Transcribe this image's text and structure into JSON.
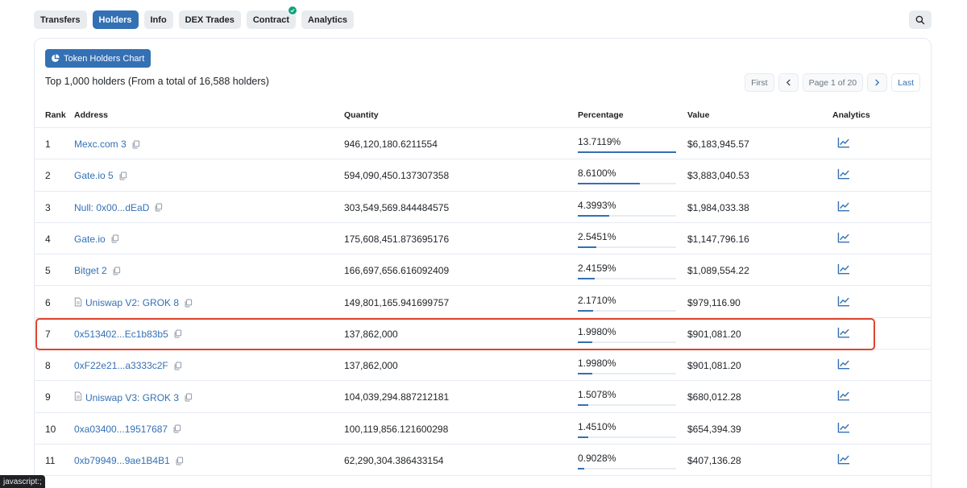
{
  "tabs": [
    {
      "label": "Transfers"
    },
    {
      "label": "Holders",
      "active": true
    },
    {
      "label": "Info"
    },
    {
      "label": "DEX Trades"
    },
    {
      "label": "Contract",
      "verified": true
    },
    {
      "label": "Analytics"
    }
  ],
  "chart_button": "Token Holders Chart",
  "summary": "Top 1,000 holders (From a total of 16,588 holders)",
  "pager": {
    "first": "First",
    "page": "Page 1 of 20",
    "last": "Last"
  },
  "columns": {
    "rank": "Rank",
    "address": "Address",
    "quantity": "Quantity",
    "percentage": "Percentage",
    "value": "Value",
    "analytics": "Analytics"
  },
  "rows": [
    {
      "rank": "1",
      "address": "Mexc.com 3",
      "quantity": "946,120,180.6211554",
      "percentage": "13.7119%",
      "pct_fill": 1.0,
      "value": "$6,183,945.57"
    },
    {
      "rank": "2",
      "address": "Gate.io 5",
      "quantity": "594,090,450.137307358",
      "percentage": "8.6100%",
      "pct_fill": 0.628,
      "value": "$3,883,040.53"
    },
    {
      "rank": "3",
      "address": "Null: 0x00...dEaD",
      "quantity": "303,549,569.844484575",
      "percentage": "4.3993%",
      "pct_fill": 0.321,
      "value": "$1,984,033.38"
    },
    {
      "rank": "4",
      "address": "Gate.io",
      "quantity": "175,608,451.873695176",
      "percentage": "2.5451%",
      "pct_fill": 0.186,
      "value": "$1,147,796.16"
    },
    {
      "rank": "5",
      "address": "Bitget 2",
      "quantity": "166,697,656.616092409",
      "percentage": "2.4159%",
      "pct_fill": 0.176,
      "value": "$1,089,554.22"
    },
    {
      "rank": "6",
      "address": "Uniswap V2: GROK 8",
      "contract": true,
      "quantity": "149,801,165.941699757",
      "percentage": "2.1710%",
      "pct_fill": 0.158,
      "value": "$979,116.90"
    },
    {
      "rank": "7",
      "address": "0x513402...Ec1b83b5",
      "quantity": "137,862,000",
      "percentage": "1.9980%",
      "pct_fill": 0.146,
      "value": "$901,081.20"
    },
    {
      "rank": "8",
      "address": "0xF22e21...a3333c2F",
      "quantity": "137,862,000",
      "percentage": "1.9980%",
      "pct_fill": 0.146,
      "value": "$901,081.20"
    },
    {
      "rank": "9",
      "address": "Uniswap V3: GROK 3",
      "contract": true,
      "quantity": "104,039,294.887212181",
      "percentage": "1.5078%",
      "pct_fill": 0.11,
      "value": "$680,012.28"
    },
    {
      "rank": "10",
      "address": "0xa03400...19517687",
      "quantity": "100,119,856.121600298",
      "percentage": "1.4510%",
      "pct_fill": 0.106,
      "value": "$654,394.39"
    },
    {
      "rank": "11",
      "address": "0xb79949...9ae1B4B1",
      "quantity": "62,290,304.386433154",
      "percentage": "0.9028%",
      "pct_fill": 0.066,
      "value": "$407,136.28"
    }
  ],
  "status_tip": "javascript:;"
}
